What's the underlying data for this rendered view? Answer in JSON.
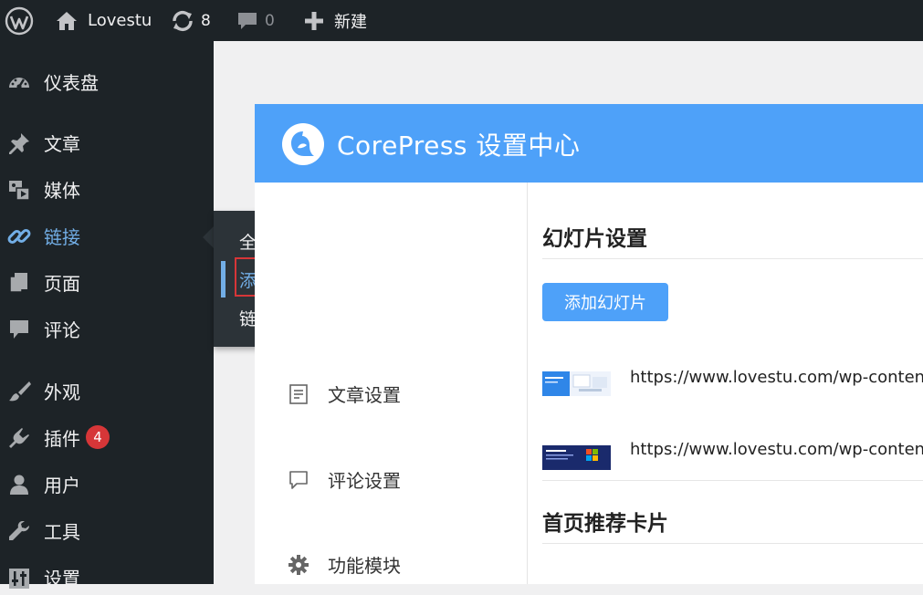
{
  "adminbar": {
    "site_name": "Lovestu",
    "updates_count": "8",
    "comments_count": "0",
    "new_label": "新建"
  },
  "sidebar": {
    "items": [
      {
        "label": "仪表盘",
        "icon": "dashboard-icon"
      },
      {
        "label": "文章",
        "icon": "pin-icon"
      },
      {
        "label": "媒体",
        "icon": "media-icon"
      },
      {
        "label": "链接",
        "icon": "link-icon",
        "active": true
      },
      {
        "label": "页面",
        "icon": "page-icon"
      },
      {
        "label": "评论",
        "icon": "comment-icon"
      },
      {
        "label": "外观",
        "icon": "brush-icon"
      },
      {
        "label": "插件",
        "icon": "plugin-icon",
        "badge": "4"
      },
      {
        "label": "用户",
        "icon": "user-icon"
      },
      {
        "label": "工具",
        "icon": "wrench-icon"
      },
      {
        "label": "设置",
        "icon": "settings-icon"
      }
    ]
  },
  "flyout": {
    "items": [
      "全部链接",
      "添加新链接",
      "链接分类"
    ],
    "current_index": 1
  },
  "panel": {
    "title": "CorePress 设置中心",
    "nav": [
      {
        "label": "文章设置",
        "icon": "document-icon"
      },
      {
        "label": "评论设置",
        "icon": "chat-icon"
      },
      {
        "label": "功能模块",
        "icon": "gear-icon"
      }
    ],
    "slides_title": "幻灯片设置",
    "add_slide_label": "添加幻灯片",
    "slides": [
      {
        "url": "https://www.lovestu.com/wp-conten"
      },
      {
        "url": "https://www.lovestu.com/wp-conten"
      }
    ],
    "cards_title": "首页推荐卡片"
  },
  "colors": {
    "adminbar": "#1d2327",
    "accent_blue": "#4ea1f9",
    "wp_highlight": "#72aee6",
    "badge_red": "#d63638"
  }
}
